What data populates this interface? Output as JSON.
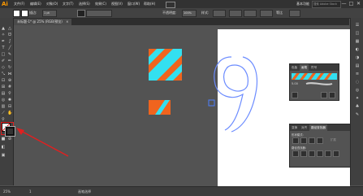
{
  "menubar": {
    "logo": "Ai",
    "items": [
      "文件(F)",
      "编辑(E)",
      "对象(O)",
      "文字(T)",
      "选择(S)",
      "效果(C)",
      "视图(V)",
      "窗口(W)",
      "帮助(H)"
    ],
    "workspace": "基本功能",
    "search_placeholder": "搜索 Adobe Stock",
    "window_buttons": [
      "—",
      "□",
      "✕"
    ]
  },
  "control_bar": {
    "stroke_label": "描边:",
    "opacity_label": "不透明度:",
    "opacity_value": "100%",
    "style_label": "样式:",
    "uniform_label": "等比",
    "stroke_weight": "1 pt"
  },
  "document_tab": {
    "label": "未标题-1* @ 25% (RGB/预览)",
    "close": "×"
  },
  "status_bar": {
    "zoom": "25%",
    "page": "1",
    "mode": "画笔选择"
  },
  "brush_panel": {
    "tabs": [
      "色板",
      "画笔",
      "符号"
    ],
    "active_tab": "画笔",
    "stroke_size": "5.00"
  },
  "pathfinder_panel": {
    "tabs": [
      "变换",
      "对齐",
      "路径查找器"
    ],
    "active_tab": "路径查找器",
    "shape_modes_label": "形状模式:",
    "pathfinders_label": "路径查找器:",
    "expand_label": "扩展"
  },
  "canvas": {
    "big_glyph": "9"
  },
  "colors": {
    "stripe_orange": "#f0641e",
    "stripe_cyan": "#33e0f0",
    "arrow_red": "#e02020",
    "menu_bg": "#323232",
    "canvas_bg": "#535353",
    "selection_blue": "#4d7fff"
  }
}
